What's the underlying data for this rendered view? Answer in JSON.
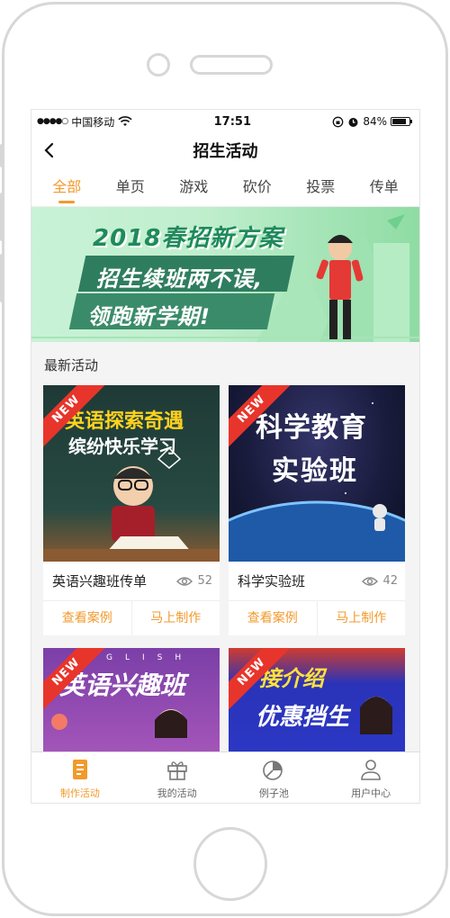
{
  "status_bar": {
    "carrier": "中国移动",
    "time": "17:51",
    "battery_text": "84%",
    "battery_level": 0.84
  },
  "nav": {
    "title": "招生活动"
  },
  "tabs": [
    {
      "label": "全部",
      "active": true
    },
    {
      "label": "单页",
      "active": false
    },
    {
      "label": "游戏",
      "active": false
    },
    {
      "label": "砍价",
      "active": false
    },
    {
      "label": "投票",
      "active": false
    },
    {
      "label": "传单",
      "active": false
    }
  ],
  "banner": {
    "headline": "2018春招新方案",
    "line1": "招生续班两不误,",
    "line2": "领跑新学期!"
  },
  "section": {
    "title": "最新活动"
  },
  "cards": [
    {
      "badge": "NEW",
      "cover_line1": "英语探索奇遇",
      "cover_line2": "缤纷快乐学习",
      "name": "英语兴趣班传单",
      "views": "52",
      "action_left": "查看案例",
      "action_right": "马上制作"
    },
    {
      "badge": "NEW",
      "cover_line1": "科学教育",
      "cover_line2": "实验班",
      "name": "科学实验班",
      "views": "42",
      "action_left": "查看案例",
      "action_right": "马上制作"
    },
    {
      "badge": "NEW",
      "cover_line1": "英语兴趣班",
      "cover_line2": "GLISH"
    },
    {
      "badge": "NEW",
      "cover_line1": "接介绍",
      "cover_line2": "优惠挡生"
    }
  ],
  "tabbar": [
    {
      "label": "制作活动",
      "icon": "make-activity-icon",
      "active": true
    },
    {
      "label": "我的活动",
      "icon": "gift-icon",
      "active": false
    },
    {
      "label": "例子池",
      "icon": "pie-chart-icon",
      "active": false
    },
    {
      "label": "用户中心",
      "icon": "user-icon",
      "active": false
    }
  ],
  "colors": {
    "accent": "#f29a2c",
    "ribbon": "#e8352b",
    "banner_green": "#2f7d5f"
  }
}
